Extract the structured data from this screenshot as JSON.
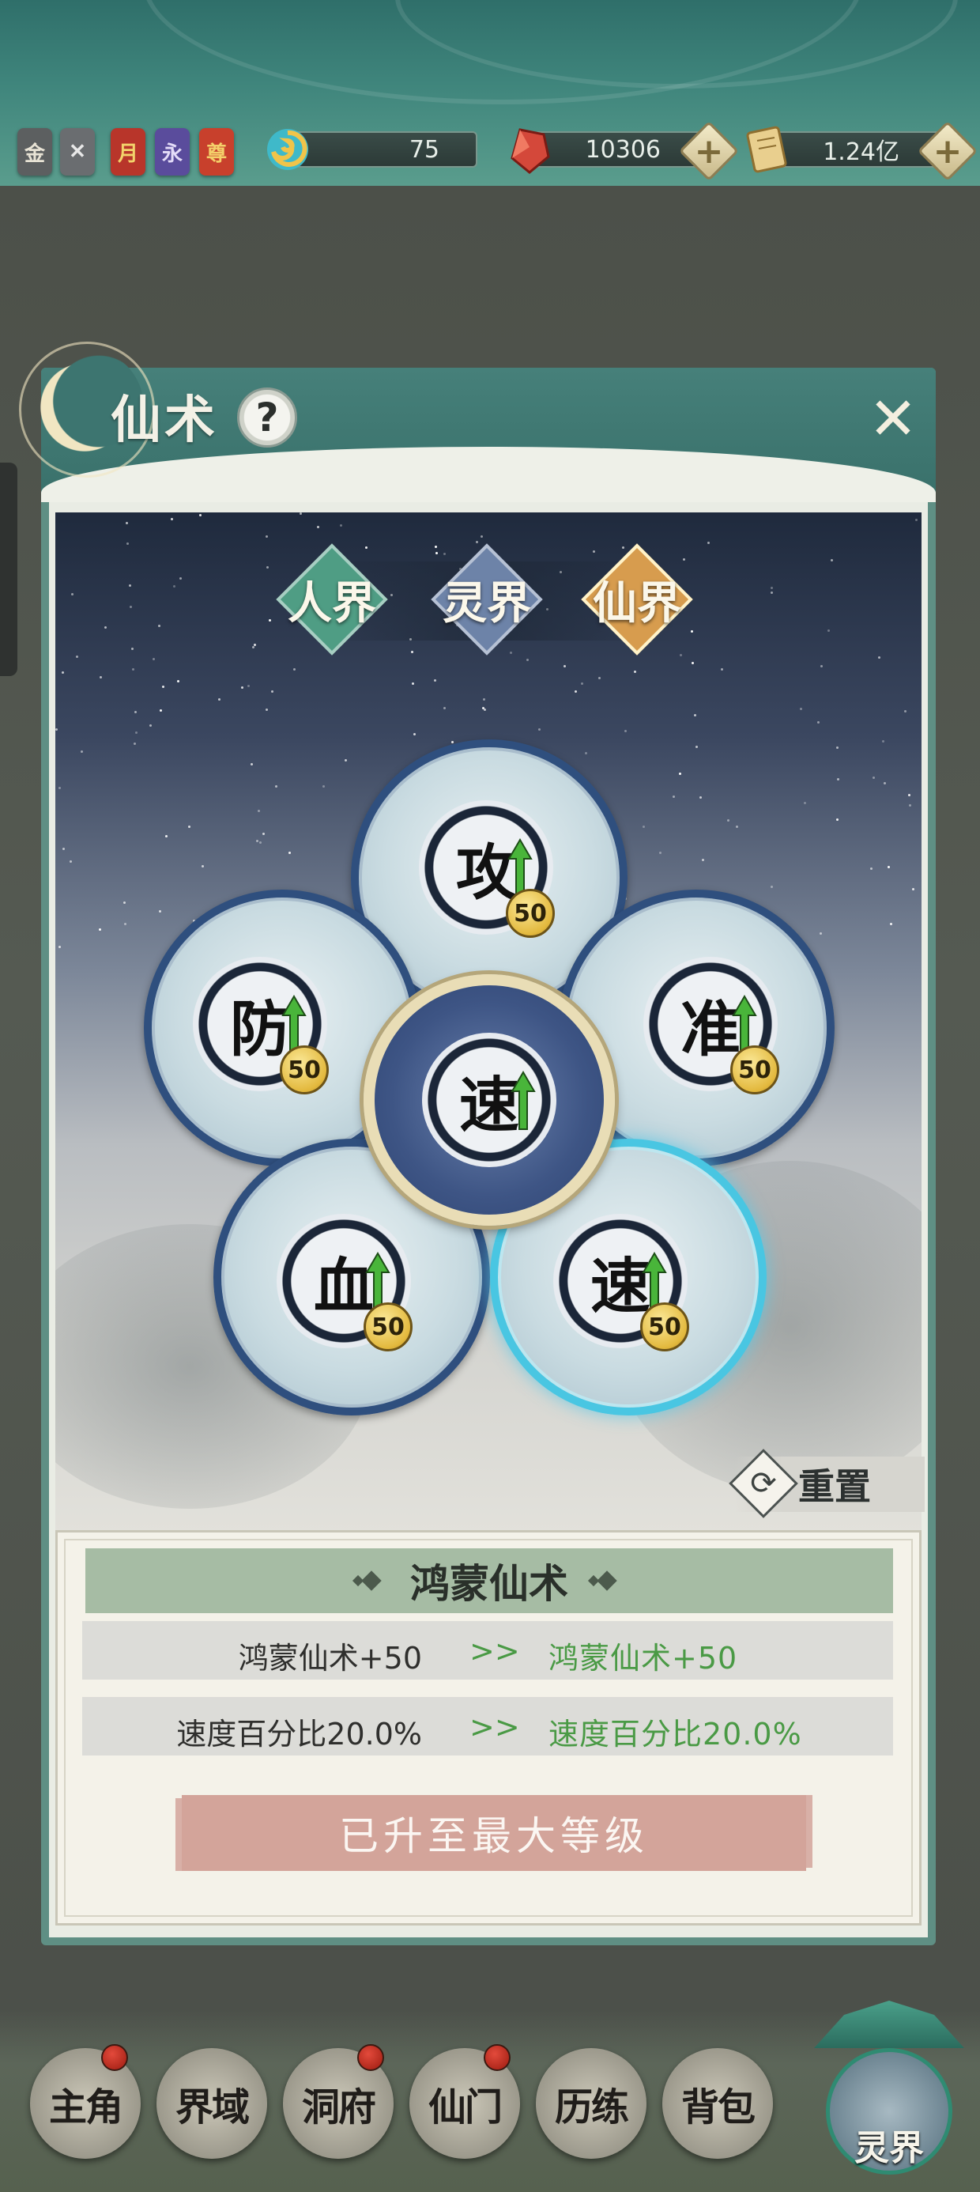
{
  "top_bar": {
    "buffs": [
      {
        "name": "buff-gold",
        "label": "金",
        "bg": "#5c5f60",
        "fg": "#e8e3d5"
      },
      {
        "name": "buff-x",
        "label": "✕",
        "bg": "#6a6d70",
        "fg": "#e8e8e8"
      },
      {
        "name": "buff-month",
        "label": "月",
        "bg": "#b8352a",
        "fg": "#f3d36b"
      },
      {
        "name": "buff-forever",
        "label": "永",
        "bg": "#5a4c9c",
        "fg": "#e4dcf8"
      },
      {
        "name": "buff-zun",
        "label": "尊",
        "bg": "#c8402c",
        "fg": "#f4d06a"
      }
    ],
    "resources": [
      {
        "name": "stamina",
        "value": "75",
        "icon": "spiral-jade-icon",
        "has_plus": false
      },
      {
        "name": "spirit-stone",
        "value": "10306",
        "icon": "red-crystal-icon",
        "has_plus": true
      },
      {
        "name": "scroll-currency",
        "value": "1.24亿",
        "icon": "scroll-icon",
        "has_plus": true
      }
    ]
  },
  "panel": {
    "title": "仙术",
    "help_label": "?",
    "close_label": "✕"
  },
  "realm_tabs": [
    {
      "name": "tab-human-realm",
      "label": "人界",
      "color": "#4f9d84",
      "selected": false
    },
    {
      "name": "tab-spirit-realm",
      "label": "灵界",
      "color": "#6d83a8",
      "selected": false
    },
    {
      "name": "tab-immortal-realm",
      "label": "仙界",
      "color": "#d79c4e",
      "selected": true
    }
  ],
  "skills": {
    "top": {
      "glyph": "攻",
      "level": "50"
    },
    "left": {
      "glyph": "防",
      "level": "50"
    },
    "right": {
      "glyph": "准",
      "level": "50"
    },
    "bottom_left": {
      "glyph": "血",
      "level": "50"
    },
    "bottom_right": {
      "glyph": "速",
      "level": "50",
      "selected": true
    },
    "center": {
      "glyph": "速"
    }
  },
  "reset": {
    "label": "重置"
  },
  "info": {
    "title": "鸿蒙仙术",
    "rows": [
      {
        "current": "鸿蒙仙术+50",
        "arrow": ">>",
        "next": "鸿蒙仙术+50"
      },
      {
        "current": "速度百分比20.0%",
        "arrow": ">>",
        "next": "速度百分比20.0%"
      }
    ],
    "max_button": "已升至最大等级"
  },
  "bottom_nav": [
    {
      "name": "nav-protagonist",
      "label": "主角",
      "has_dot": true
    },
    {
      "name": "nav-domain",
      "label": "界域",
      "has_dot": false
    },
    {
      "name": "nav-cave",
      "label": "洞府",
      "has_dot": true
    },
    {
      "name": "nav-sect",
      "label": "仙门",
      "has_dot": true
    },
    {
      "name": "nav-training",
      "label": "历练",
      "has_dot": false
    },
    {
      "name": "nav-backpack",
      "label": "背包",
      "has_dot": false
    }
  ],
  "realm_nav": {
    "label": "灵界"
  }
}
